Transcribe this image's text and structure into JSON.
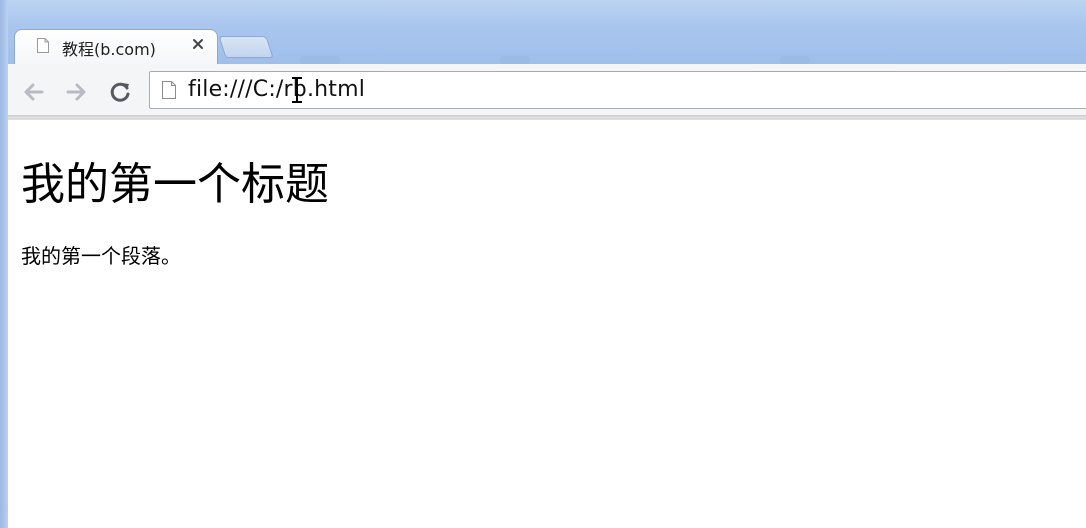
{
  "browser": {
    "tab": {
      "title": "教程(b.com)",
      "favicon": "page-icon",
      "close": "close-icon"
    },
    "toolbar": {
      "back": "back-arrow-icon",
      "forward": "forward-arrow-icon",
      "reload": "reload-icon",
      "address": "file:///C:/rb.html"
    },
    "colors": {
      "frame": "#a9c6ee",
      "toolbar": "#f4f5f6"
    }
  },
  "page": {
    "heading": "我的第一个标题",
    "paragraph": "我的第一个段落。"
  }
}
